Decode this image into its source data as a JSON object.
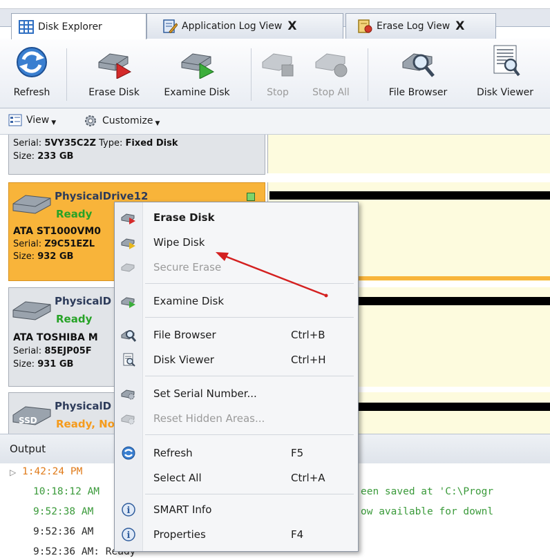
{
  "tabs": [
    {
      "label": "Disk Explorer",
      "closable": false,
      "active": true
    },
    {
      "label": "Application Log View",
      "closable": true
    },
    {
      "label": "Erase Log View",
      "closable": true
    }
  ],
  "tab_close_glyph": "X",
  "ribbon": [
    {
      "label": "Refresh",
      "icon": "refresh-icon",
      "enabled": true
    },
    {
      "label": "Erase Disk",
      "icon": "erase-disk-icon",
      "enabled": true
    },
    {
      "label": "Examine Disk",
      "icon": "examine-disk-icon",
      "enabled": true
    },
    {
      "label": "Stop",
      "icon": "stop-icon",
      "enabled": false
    },
    {
      "label": "Stop All",
      "icon": "stop-all-icon",
      "enabled": false
    },
    {
      "label": "File Browser",
      "icon": "file-browser-icon",
      "enabled": true
    },
    {
      "label": "Disk Viewer",
      "icon": "disk-viewer-icon",
      "enabled": true
    }
  ],
  "viewbar": {
    "view": "View",
    "customize": "Customize"
  },
  "disks": {
    "top": {
      "serial_label": "Serial:",
      "serial": "5VY35C2Z",
      "type_label": "Type:",
      "type": "Fixed Disk",
      "size_label": "Size:",
      "size": "233 GB"
    },
    "drive12": {
      "name": "PhysicalDrive12",
      "status": "Ready",
      "model": "ATA ST1000VM0",
      "serial_label": "Serial:",
      "serial": "Z9C51EZL",
      "size_label": "Size:",
      "size": "932 GB"
    },
    "drive_b": {
      "name": "PhysicalD",
      "status": "Ready",
      "model": "ATA TOSHIBA M",
      "serial_label": "Serial:",
      "serial": "85EJP05F",
      "size_label": "Size:",
      "size": "931 GB"
    },
    "drive_c": {
      "name": "PhysicalD",
      "status": "Ready, No",
      "badge": "SSD"
    }
  },
  "output": {
    "title": "Output",
    "lines": [
      {
        "text": "1:42:24 PM",
        "color": "#e07b1a",
        "expander": true
      },
      {
        "text": "10:18:12 AM",
        "color": "#3a9a3a"
      },
      {
        "text": "9:52:38 AM",
        "color": "#3a9a3a"
      },
      {
        "text": "9:52:36 AM",
        "color": "#2a2a2a"
      },
      {
        "text": "9:52:36 AM: Ready",
        "color": "#2a2a2a"
      }
    ],
    "right_fragments": [
      {
        "text": "een saved at 'C:\\Progr",
        "color": "#3a9a3a"
      },
      {
        "text": "ow available for downl",
        "color": "#3a9a3a"
      }
    ]
  },
  "context_menu": {
    "items": [
      {
        "label": "Erase Disk",
        "shortcut": "",
        "icon": "erase-disk-icon",
        "bold": true,
        "enabled": true
      },
      {
        "label": "Wipe Disk",
        "shortcut": "",
        "icon": "wipe-disk-icon",
        "enabled": true
      },
      {
        "label": "Secure Erase",
        "shortcut": "",
        "icon": "secure-erase-icon",
        "enabled": false
      },
      {
        "label": "Examine Disk",
        "shortcut": "",
        "icon": "examine-disk-icon",
        "enabled": true
      },
      {
        "label": "File Browser",
        "shortcut": "Ctrl+B",
        "icon": "file-browser-icon",
        "enabled": true
      },
      {
        "label": "Disk Viewer",
        "shortcut": "Ctrl+H",
        "icon": "disk-viewer-icon",
        "enabled": true
      },
      {
        "label": "Set Serial Number...",
        "shortcut": "",
        "icon": "set-serial-icon",
        "enabled": true
      },
      {
        "label": "Reset Hidden Areas...",
        "shortcut": "",
        "icon": "reset-hidden-icon",
        "enabled": false
      },
      {
        "label": "Refresh",
        "shortcut": "F5",
        "icon": "refresh-icon",
        "enabled": true
      },
      {
        "label": "Select All",
        "shortcut": "Ctrl+A",
        "icon": "",
        "enabled": true
      },
      {
        "label": "SMART Info",
        "shortcut": "",
        "icon": "info-icon",
        "enabled": true
      },
      {
        "label": "Properties",
        "shortcut": "F4",
        "icon": "info-icon",
        "enabled": true
      }
    ]
  },
  "colors": {
    "accent_orange": "#f8b43a",
    "ready_green": "#27a327",
    "arrow_red": "#d42020"
  }
}
